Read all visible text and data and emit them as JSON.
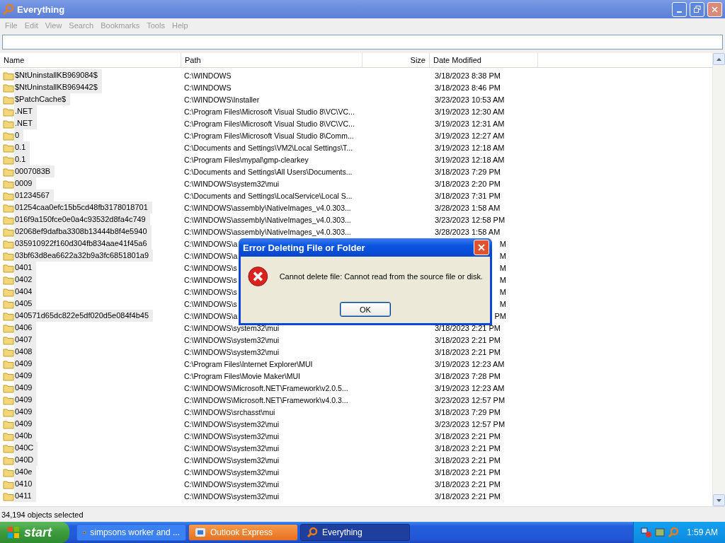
{
  "window": {
    "title": "Everything"
  },
  "menu": [
    "File",
    "Edit",
    "View",
    "Search",
    "Bookmarks",
    "Tools",
    "Help"
  ],
  "columns": [
    {
      "label": "Name"
    },
    {
      "label": "Path"
    },
    {
      "label": "Size"
    },
    {
      "label": "Date Modified"
    }
  ],
  "rows": [
    {
      "name": "$NtUninstallKB969084$",
      "path": "C:\\WINDOWS",
      "date": "3/18/2023 8:38 PM",
      "selected": true
    },
    {
      "name": "$NtUninstallKB969442$",
      "path": "C:\\WINDOWS",
      "date": "3/18/2023 8:46 PM",
      "selected": true
    },
    {
      "name": "$PatchCache$",
      "path": "C:\\WINDOWS\\Installer",
      "date": "3/23/2023 10:53 AM",
      "selected": true
    },
    {
      "name": ".NET",
      "path": "C:\\Program Files\\Microsoft Visual Studio 8\\VC\\VC...",
      "date": "3/19/2023 12:30 AM",
      "selected": true
    },
    {
      "name": ".NET",
      "path": "C:\\Program Files\\Microsoft Visual Studio 8\\VC\\VC...",
      "date": "3/19/2023 12:31 AM",
      "selected": true
    },
    {
      "name": "0",
      "path": "C:\\Program Files\\Microsoft Visual Studio 8\\Comm...",
      "date": "3/19/2023 12:27 AM",
      "selected": true
    },
    {
      "name": "0.1",
      "path": "C:\\Documents and Settings\\VM2\\Local Settings\\T...",
      "date": "3/19/2023 12:18 AM",
      "selected": true
    },
    {
      "name": "0.1",
      "path": "C:\\Program Files\\mypal\\gmp-clearkey",
      "date": "3/19/2023 12:18 AM",
      "selected": true
    },
    {
      "name": "0007083B",
      "path": "C:\\Documents and Settings\\All Users\\Documents...",
      "date": "3/18/2023 7:29 PM",
      "selected": true
    },
    {
      "name": "0009",
      "path": "C:\\WINDOWS\\system32\\mui",
      "date": "3/18/2023 2:20 PM",
      "selected": true
    },
    {
      "name": "01234567",
      "path": "C:\\Documents and Settings\\LocalService\\Local S...",
      "date": "3/18/2023 7:31 PM",
      "selected": true
    },
    {
      "name": "01254caa0efc15b5cd48fb3178018701",
      "path": "C:\\WINDOWS\\assembly\\NativeImages_v4.0.303...",
      "date": "3/28/2023 1:58 AM",
      "selected": true
    },
    {
      "name": "016f9a150fce0e0a4c93532d8fa4c749",
      "path": "C:\\WINDOWS\\assembly\\NativeImages_v4.0.303...",
      "date": "3/23/2023 12:58 PM",
      "selected": true
    },
    {
      "name": "02068ef9dafba3308b13444b8f4e5940",
      "path": "C:\\WINDOWS\\assembly\\NativeImages_v4.0.303...",
      "date": "3/28/2023 1:58 AM",
      "selected": true
    },
    {
      "name": "035910922f160d304fb834aae41f45a6",
      "path": "C:\\WINDOWS\\a",
      "date": "M",
      "selected": true,
      "covered": true
    },
    {
      "name": "03bf63d8ea6622a32b9a3fc6851801a9",
      "path": "C:\\WINDOWS\\a",
      "date": "M",
      "selected": true,
      "covered": true
    },
    {
      "name": "0401",
      "path": "C:\\WINDOWS\\s",
      "date": "M",
      "selected": true,
      "covered": true
    },
    {
      "name": "0402",
      "path": "C:\\WINDOWS\\s",
      "date": "M",
      "selected": true,
      "covered": true
    },
    {
      "name": "0404",
      "path": "C:\\WINDOWS\\s",
      "date": "M",
      "selected": true,
      "covered": true
    },
    {
      "name": "0405",
      "path": "C:\\WINDOWS\\s",
      "date": "M",
      "selected": true,
      "covered": true
    },
    {
      "name": "040571d65dc822e5df020d5e084f4b45",
      "path": "C:\\WINDOWS\\a",
      "date": "PM",
      "selected": true,
      "covered": true
    },
    {
      "name": "0406",
      "path": "C:\\WINDOWS\\system32\\mui",
      "date": "3/18/2023 2:21 PM",
      "selected": true
    },
    {
      "name": "0407",
      "path": "C:\\WINDOWS\\system32\\mui",
      "date": "3/18/2023 2:21 PM",
      "selected": true
    },
    {
      "name": "0408",
      "path": "C:\\WINDOWS\\system32\\mui",
      "date": "3/18/2023 2:21 PM",
      "selected": true
    },
    {
      "name": "0409",
      "path": "C:\\Program Files\\Internet Explorer\\MUI",
      "date": "3/19/2023 12:23 AM",
      "selected": true
    },
    {
      "name": "0409",
      "path": "C:\\Program Files\\Movie Maker\\MUI",
      "date": "3/18/2023 7:28 PM",
      "selected": true
    },
    {
      "name": "0409",
      "path": "C:\\WINDOWS\\Microsoft.NET\\Framework\\v2.0.5...",
      "date": "3/19/2023 12:23 AM",
      "selected": true
    },
    {
      "name": "0409",
      "path": "C:\\WINDOWS\\Microsoft.NET\\Framework\\v4.0.3...",
      "date": "3/23/2023 12:57 PM",
      "selected": true
    },
    {
      "name": "0409",
      "path": "C:\\WINDOWS\\srchasst\\mui",
      "date": "3/18/2023 7:29 PM",
      "selected": true
    },
    {
      "name": "0409",
      "path": "C:\\WINDOWS\\system32\\mui",
      "date": "3/23/2023 12:57 PM",
      "selected": true
    },
    {
      "name": "040b",
      "path": "C:\\WINDOWS\\system32\\mui",
      "date": "3/18/2023 2:21 PM",
      "selected": true
    },
    {
      "name": "040C",
      "path": "C:\\WINDOWS\\system32\\mui",
      "date": "3/18/2023 2:21 PM",
      "selected": true
    },
    {
      "name": "040D",
      "path": "C:\\WINDOWS\\system32\\mui",
      "date": "3/18/2023 2:21 PM",
      "selected": true
    },
    {
      "name": "040e",
      "path": "C:\\WINDOWS\\system32\\mui",
      "date": "3/18/2023 2:21 PM",
      "selected": true
    },
    {
      "name": "0410",
      "path": "C:\\WINDOWS\\system32\\mui",
      "date": "3/18/2023 2:21 PM",
      "selected": true
    },
    {
      "name": "0411",
      "path": "C:\\WINDOWS\\system32\\mui",
      "date": "3/18/2023 2:21 PM",
      "selected": true
    }
  ],
  "status_bar": "34,194 objects selected",
  "dialog": {
    "title": "Error Deleting File or Folder",
    "message": "Cannot delete file: Cannot read from the source file or disk.",
    "button": "OK"
  },
  "taskbar": {
    "start": "start",
    "tasks": [
      {
        "label": "simpsons worker and ...",
        "selected": false,
        "flashing": false
      },
      {
        "label": "Outlook Express",
        "selected": false,
        "flashing": true
      },
      {
        "label": "Everything",
        "selected": true,
        "flashing": false
      }
    ],
    "clock": "1:59 AM"
  }
}
